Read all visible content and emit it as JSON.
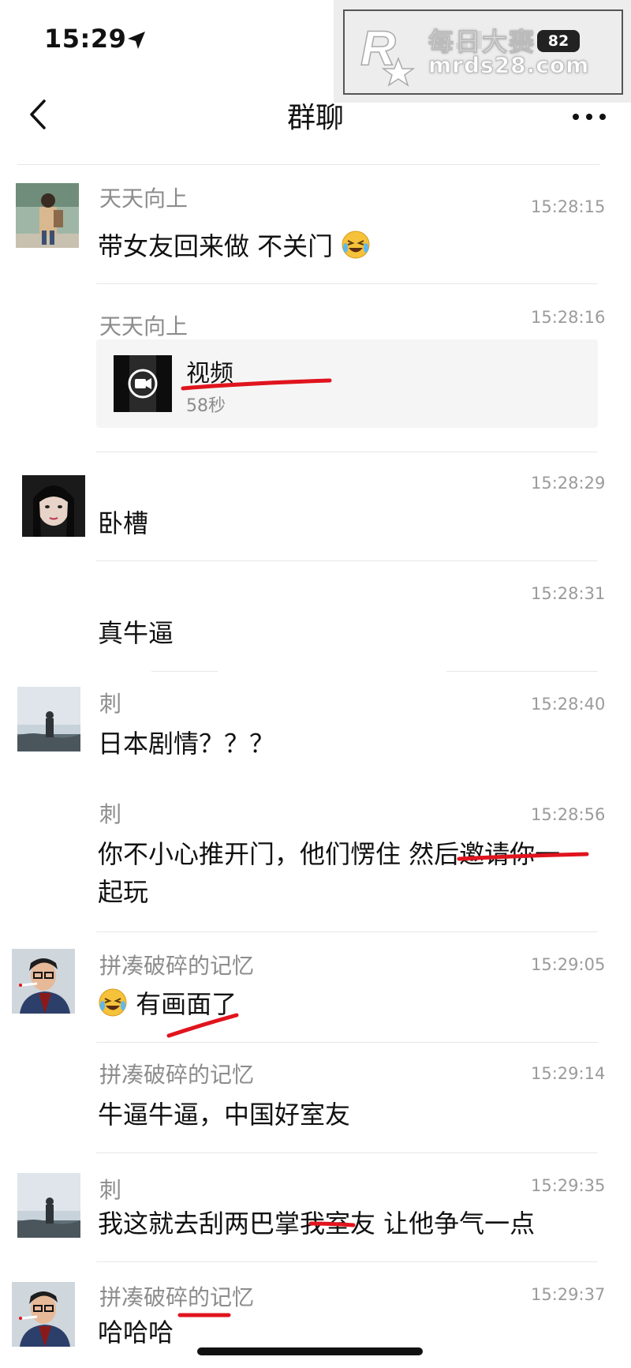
{
  "status_bar": {
    "time": "15:29",
    "battery": "82"
  },
  "watermark": {
    "title": "每日大赛",
    "url": "mrds28.com",
    "battery": "82"
  },
  "nav": {
    "title": "群聊"
  },
  "messages": [
    {
      "sender": "天天向上",
      "time": "15:28:15",
      "text": "带女友回来做 不关门",
      "emoji": "laughing-crying-emoji"
    },
    {
      "sender": "天天向上",
      "time": "15:28:16",
      "video_title": "视频",
      "video_duration": "58秒"
    },
    {
      "sender": "",
      "time": "15:28:29",
      "text": "卧槽"
    },
    {
      "sender": "",
      "time": "15:28:31",
      "text": "真牛逼"
    },
    {
      "sender": "刺",
      "time": "15:28:40",
      "text": "日本剧情？？？"
    },
    {
      "sender": "刺",
      "time": "15:28:56",
      "text": "你不小心推开门，他们愣住 然后邀请你一",
      "text2": "起玩"
    },
    {
      "sender": "拼凑破碎的记忆",
      "time": "15:29:05",
      "text": "有画面了",
      "emoji": "laughing-crying-emoji"
    },
    {
      "sender": "拼凑破碎的记忆",
      "time": "15:29:14",
      "text": "牛逼牛逼，中国好室友"
    },
    {
      "sender": "刺",
      "time": "15:29:35",
      "text": "我这就去刮两巴掌我室友 让他争气一点"
    },
    {
      "sender": "拼凑破碎的记忆",
      "time": "15:29:37",
      "text": "哈哈哈"
    }
  ],
  "colors": {
    "annotation_red": "#e0141e",
    "sender_gray": "#8c8c8c",
    "separator": "#e6e6e6"
  }
}
